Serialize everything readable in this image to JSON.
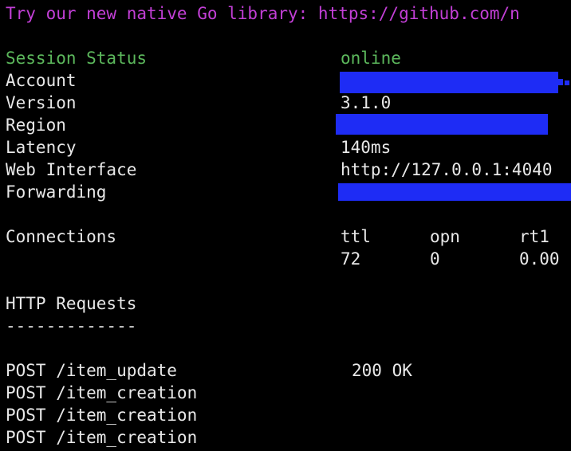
{
  "colors": {
    "background": "#000000",
    "text": "#e8e8e8",
    "banner": "#c23fd6",
    "status_green": "#5cb85c",
    "redaction": "#1e2cf5"
  },
  "banner": "Try our new native Go library: https://github.com/n",
  "status": {
    "session_label": "Session Status",
    "session_value": "online",
    "account_label": "Account",
    "version_label": "Version",
    "version_value": "3.1.0",
    "region_label": "Region",
    "latency_label": "Latency",
    "latency_value": "140ms",
    "web_label": "Web Interface",
    "web_value": "http://127.0.0.1:4040",
    "forwarding_label": "Forwarding"
  },
  "connections": {
    "label": "Connections",
    "headers": [
      "ttl",
      "opn",
      "rt1"
    ],
    "values": [
      "72",
      "0",
      "0.00"
    ]
  },
  "http": {
    "title": "HTTP Requests",
    "divider": "-------------",
    "requests": [
      {
        "method_path": "POST /item_update",
        "status": "200 OK"
      },
      {
        "method_path": "POST /item_creation",
        "status": ""
      },
      {
        "method_path": "POST /item_creation",
        "status": ""
      },
      {
        "method_path": "POST /item_creation",
        "status": ""
      }
    ]
  }
}
